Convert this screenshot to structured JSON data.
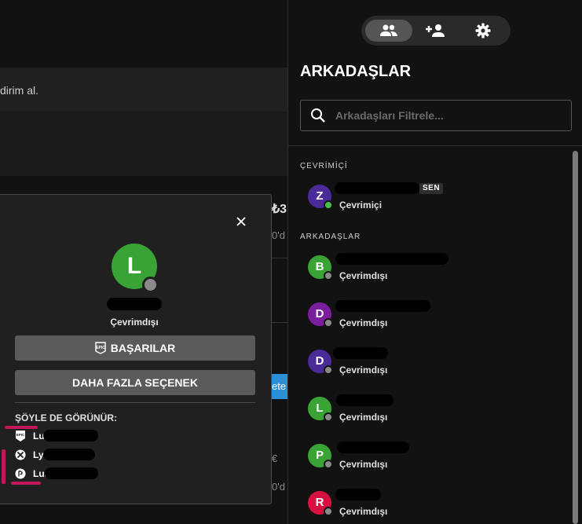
{
  "background": {
    "promo_text": "dirim al.",
    "price_fragment": "₺3",
    "text_fragment_1": "0'd",
    "text_fragment_2": "0'd",
    "text_fragment_3": "0'd",
    "button_fragment": "ete",
    "symbol_fragment": "€"
  },
  "profile_modal": {
    "avatar_initial": "L",
    "avatar_color": "#3aa335",
    "status": "Çevrimdışı",
    "achievements_button": "BAŞARILAR",
    "more_options_button": "DAHA FAZLA SEÇENEK",
    "also_known_as_title": "ŞÖYLE DE GÖRÜNÜR:",
    "accounts": [
      {
        "platform": "epic",
        "icon": "epic-games-icon",
        "name_prefix": "Lu"
      },
      {
        "platform": "xbox",
        "icon": "xbox-icon",
        "name_prefix": "Ly"
      },
      {
        "platform": "playstation",
        "icon": "playstation-icon",
        "name_prefix": "Lus"
      }
    ]
  },
  "friends_panel": {
    "tabs": [
      {
        "icon": "friends-icon",
        "active": true
      },
      {
        "icon": "add-friend-icon",
        "active": false
      },
      {
        "icon": "gear-icon",
        "active": false
      }
    ],
    "title": "ARKADAŞLAR",
    "search_placeholder": "Arkadaşları Filtrele...",
    "online_section": "ÇEVRİMİÇİ",
    "friends_section": "ARKADAŞLAR",
    "self": {
      "initial": "Z",
      "color": "#4b2a9a",
      "status": "Çevrimiçi",
      "badge": "SEN"
    },
    "friends": [
      {
        "initial": "B",
        "color": "#3aa335",
        "status": "Çevrimdışı"
      },
      {
        "initial": "D",
        "color": "#7a1e9e",
        "status": "Çevrimdışı"
      },
      {
        "initial": "D",
        "color": "#4b2a9a",
        "status": "Çevrimdışı"
      },
      {
        "initial": "L",
        "color": "#3aa335",
        "status": "Çevrimdışı"
      },
      {
        "initial": "P",
        "color": "#3aa335",
        "status": "Çevrimdışı"
      },
      {
        "initial": "R",
        "color": "#d6103f",
        "status": "Çevrimdışı"
      }
    ]
  }
}
